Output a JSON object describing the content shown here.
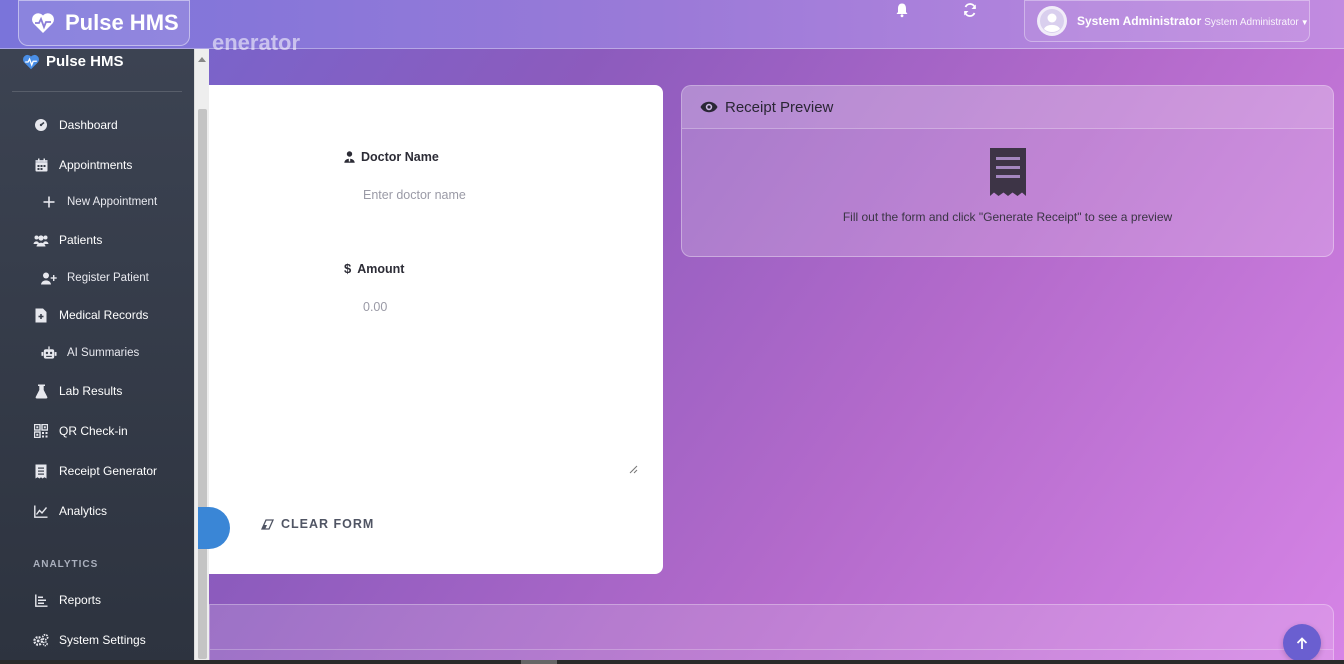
{
  "app": {
    "name": "Pulse HMS"
  },
  "user": {
    "name": "System Administrator",
    "role": "System Administrator"
  },
  "page": {
    "title_fragment": "enerator"
  },
  "sidebar": {
    "brand": "Pulse HMS",
    "items": [
      {
        "label": "Dashboard",
        "icon": "dashboard-gauge-icon"
      },
      {
        "label": "Appointments",
        "icon": "calendar-icon"
      },
      {
        "label": "New Appointment",
        "icon": "plus-icon"
      },
      {
        "label": "Patients",
        "icon": "users-icon"
      },
      {
        "label": "Register Patient",
        "icon": "user-plus-icon"
      },
      {
        "label": "Medical Records",
        "icon": "file-medical-icon"
      },
      {
        "label": "AI Summaries",
        "icon": "robot-icon"
      },
      {
        "label": "Lab Results",
        "icon": "flask-icon"
      },
      {
        "label": "QR Check-in",
        "icon": "qrcode-icon"
      },
      {
        "label": "Receipt Generator",
        "icon": "receipt-icon"
      },
      {
        "label": "Analytics",
        "icon": "chart-line-icon"
      }
    ],
    "section_label": "ANALYTICS",
    "section_items": [
      {
        "label": "Reports",
        "icon": "bar-chart-icon"
      },
      {
        "label": "System Settings",
        "icon": "cogs-icon"
      }
    ]
  },
  "form": {
    "doctor_label": "Doctor Name",
    "doctor_placeholder": "Enter doctor name",
    "amount_label": "Amount",
    "amount_placeholder": "0.00",
    "clear_label": "CLEAR FORM"
  },
  "preview": {
    "title": "Receipt Preview",
    "message": "Fill out the form and click \"Generate Receipt\" to see a preview"
  },
  "colors": {
    "accent": "#3a86d6",
    "sidebar": "#353b48",
    "scroll_top_button": "#6a5fd0"
  }
}
